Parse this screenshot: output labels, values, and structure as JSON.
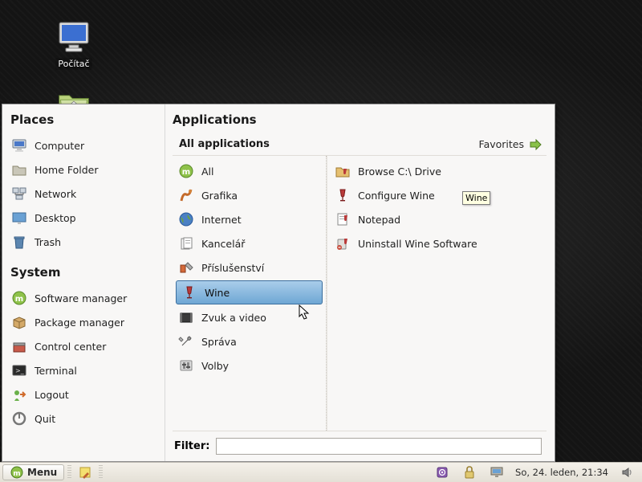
{
  "desktop": {
    "icons": [
      {
        "id": "computer",
        "label": "Počítač"
      }
    ]
  },
  "menu": {
    "left": {
      "places_title": "Places",
      "places": [
        {
          "id": "computer",
          "label": "Computer",
          "icon": "computer-icon"
        },
        {
          "id": "home",
          "label": "Home Folder",
          "icon": "folder-home-icon"
        },
        {
          "id": "network",
          "label": "Network",
          "icon": "network-icon"
        },
        {
          "id": "desktop",
          "label": "Desktop",
          "icon": "desktop-icon"
        },
        {
          "id": "trash",
          "label": "Trash",
          "icon": "trash-icon"
        }
      ],
      "system_title": "System",
      "system": [
        {
          "id": "software-manager",
          "label": "Software manager",
          "icon": "mint-icon"
        },
        {
          "id": "package-manager",
          "label": "Package manager",
          "icon": "package-icon"
        },
        {
          "id": "control-center",
          "label": "Control center",
          "icon": "toolbox-icon"
        },
        {
          "id": "terminal",
          "label": "Terminal",
          "icon": "terminal-icon"
        },
        {
          "id": "logout",
          "label": "Logout",
          "icon": "logout-icon"
        },
        {
          "id": "quit",
          "label": "Quit",
          "icon": "power-icon"
        }
      ]
    },
    "right": {
      "title": "Applications",
      "subtitle": "All applications",
      "favorites_label": "Favorites",
      "categories": [
        {
          "id": "all",
          "label": "All",
          "icon": "mint-icon"
        },
        {
          "id": "grafika",
          "label": "Grafika",
          "icon": "graphics-icon"
        },
        {
          "id": "internet",
          "label": "Internet",
          "icon": "globe-icon"
        },
        {
          "id": "kancelar",
          "label": "Kancelář",
          "icon": "office-icon"
        },
        {
          "id": "prislusenstvi",
          "label": "Příslušenství",
          "icon": "accessories-icon"
        },
        {
          "id": "wine",
          "label": "Wine",
          "icon": "wine-icon",
          "selected": true
        },
        {
          "id": "zvuk-video",
          "label": "Zvuk a video",
          "icon": "multimedia-icon"
        },
        {
          "id": "sprava",
          "label": "Správa",
          "icon": "wrench-icon"
        },
        {
          "id": "volby",
          "label": "Volby",
          "icon": "preferences-icon"
        }
      ],
      "apps": [
        {
          "id": "browse-c",
          "label": "Browse C:\\ Drive",
          "icon": "wine-folder-icon"
        },
        {
          "id": "configure-wine",
          "label": "Configure Wine",
          "icon": "wine-icon"
        },
        {
          "id": "notepad",
          "label": "Notepad",
          "icon": "wine-notepad-icon"
        },
        {
          "id": "uninstall-wine",
          "label": "Uninstall Wine Software",
          "icon": "wine-uninstall-icon"
        }
      ],
      "filter_label": "Filter:",
      "filter_value": "",
      "tooltip": "Wine"
    }
  },
  "panel": {
    "menu_label": "Menu",
    "clock": "So, 24. leden, 21:34"
  }
}
